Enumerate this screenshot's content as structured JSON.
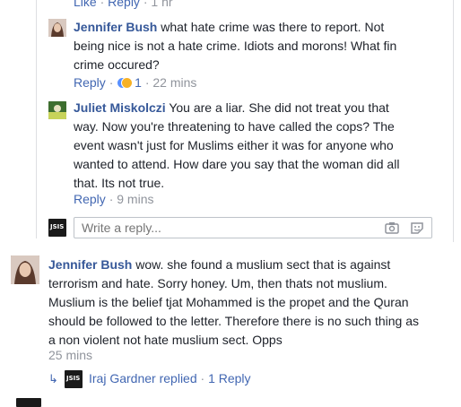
{
  "top_meta": {
    "like": "Like",
    "reply": "Reply",
    "time": "1 hr"
  },
  "comments": [
    {
      "author": "Jennifer Bush",
      "text_lines": [
        "what hate crime was there to report. Not",
        "being nice is not a hate crime. Idiots and morons! What fin",
        "crime occured?"
      ],
      "reply": "Reply",
      "reactions": "1",
      "time": "22 mins"
    },
    {
      "author": "Juliet Miskolczi",
      "text_lines": [
        "You are a liar. She did not treat you that",
        "way. Now you're threatening to have called the cops? The",
        "event wasn't just for Muslims either it was for anyone who",
        "wanted to attend. How dare you say that the woman did all",
        "that. Its not true."
      ],
      "reply": "Reply",
      "time": "9 mins"
    }
  ],
  "reply_box": {
    "placeholder": "Write a reply..."
  },
  "avatar_text": "JSIS",
  "main_comment": {
    "author": "Jennifer Bush",
    "text_lines": [
      "wow. she found a muslium sect that is against",
      "terrorism and hate. Sorry honey. Um, then thats not muslium.",
      "Muslium is the belief tjat Mohammed is the propet and the Quran",
      "should be followed to the letter. Therefore there is no such thing as",
      "a non violent not hate muslium sect. Opps"
    ],
    "time": "25 mins"
  },
  "replies_summary": {
    "author": "Iraj Gardner",
    "action": "replied",
    "count": "1 Reply"
  },
  "colors": {
    "link": "#4267b2",
    "name": "#365899",
    "meta": "#90949c",
    "border": "#dddfe2"
  }
}
